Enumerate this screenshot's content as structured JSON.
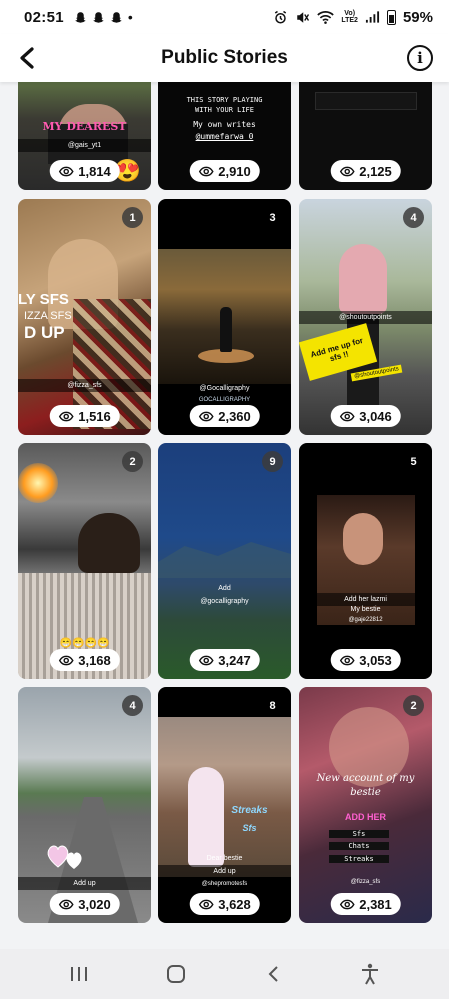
{
  "status_bar": {
    "time": "02:51",
    "network": "Vo)\nLTE2",
    "battery": "59%"
  },
  "header": {
    "title": "Public Stories"
  },
  "stories": [
    {
      "views": "1,814",
      "badge": "",
      "captions": [
        "MY DEAREST",
        "@gais_yt1"
      ]
    },
    {
      "views": "2,910",
      "badge": "",
      "captions": [
        "THIS STORY PLAYING",
        "WITH YOUR LIFE",
        "My own writes",
        "@ummefarwa_0"
      ]
    },
    {
      "views": "2,125",
      "badge": "",
      "captions": []
    },
    {
      "views": "1,516",
      "badge": "1",
      "captions": [
        "LY SFS",
        "IZZA SFS",
        "D UP",
        "@fizza_sfs"
      ]
    },
    {
      "views": "2,360",
      "badge": "3",
      "captions": [
        "@Gocalligraphy",
        "GOCALLIGRAPHY"
      ]
    },
    {
      "views": "3,046",
      "badge": "4",
      "captions": [
        "@shoutoutpoints",
        "Add me up for",
        "sfs !!",
        "@shoutoutpoints"
      ]
    },
    {
      "views": "3,168",
      "badge": "2",
      "captions": [
        "😁😁😁😁"
      ]
    },
    {
      "views": "3,247",
      "badge": "9",
      "captions": [
        "Add",
        "@gocalligraphy"
      ]
    },
    {
      "views": "3,053",
      "badge": "5",
      "captions": [
        "Add her lazmi",
        "My bestie",
        "@gaje22812"
      ]
    },
    {
      "views": "3,020",
      "badge": "4",
      "captions": [
        "Add up"
      ]
    },
    {
      "views": "3,628",
      "badge": "8",
      "captions": [
        "Streaks",
        "Sfs",
        "Dear bestie",
        "Add up",
        "@shepromotesfs"
      ]
    },
    {
      "views": "2,381",
      "badge": "2",
      "captions": [
        "New account of my",
        "bestie",
        "ADD HER",
        "Sfs",
        "Chats",
        "Streaks",
        "@fizza_sfs"
      ]
    }
  ]
}
